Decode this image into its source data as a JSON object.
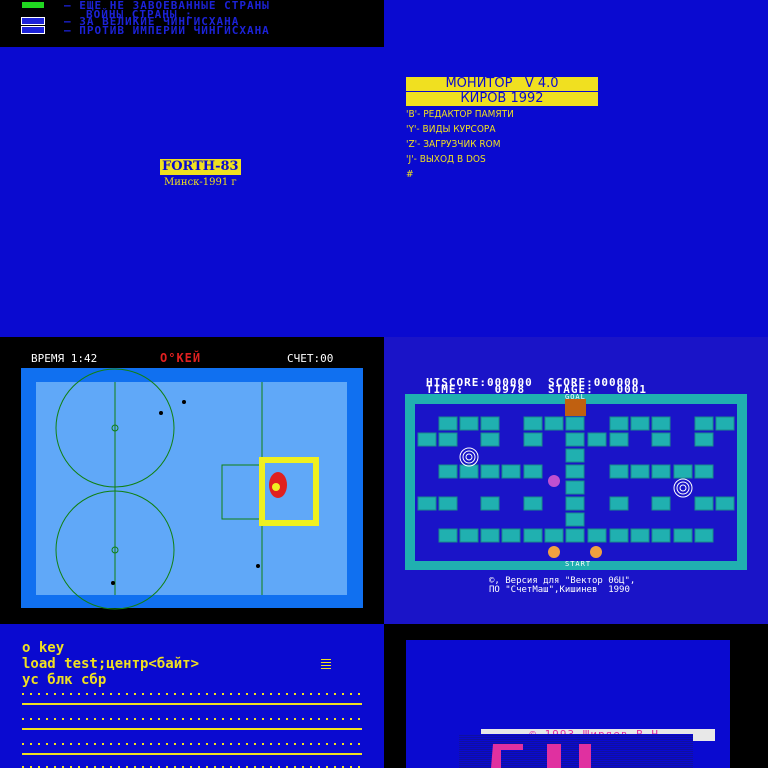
{
  "legend": {
    "rows": [
      {
        "color": "#20d820",
        "text": "– ЕЩЕ НЕ ЗАВОЕВАННЫЕ СТРАНЫ"
      },
      {
        "color": "#1c22d8",
        "text": "ВОЙНЫ СТРАНЫ :"
      },
      {
        "color": "#1c22d8",
        "text": "– ЗА ВЕЛИКИЕ ЧИНГИСХАНА"
      },
      {
        "color": "#1c22d8",
        "text": "– ПРОТИВ ИМПЕРИИ ЧИНГИСХАНА"
      }
    ]
  },
  "forth": {
    "title": "FORTH-83",
    "subtitle": "Минск-1991 г"
  },
  "monitor": {
    "title1": "МОНИТОР   V 4.0",
    "title2": "КИРОВ 1992",
    "menu": [
      "'B'- РЕДАКТОР ПАМЯТИ",
      "'Y'- ВИДЫ КУРСОРА",
      "'Z'- ЗАГРУЗЧИК ROM",
      "'J'- ВЫХОД В DOS",
      "#"
    ]
  },
  "hockey": {
    "time_label": "ВРЕМЯ 1:42",
    "logo": "О°КЕЙ",
    "score_label": "СЧЕТ:00"
  },
  "maze": {
    "hiscore_line": "HISCORE:000000  SCORE:000000",
    "time_line": "TIME:    0978   STAGE:   0001",
    "goal_label": "GOAL",
    "start_label": "START",
    "credit1": "©, Версия для \"Вектор 06Ц\",",
    "credit2": "ПО \"СчетМаш\",Кишинев  1990"
  },
  "terminal": {
    "lines": [
      "o key",
      "load test;центр<байт>",
      "ус блк сбр"
    ]
  },
  "splash": {
    "copyright": "© 1993 Ширяев В.Н."
  },
  "colors": {
    "yellow": "#f0e020",
    "blue": "#0a0ad0",
    "teal": "#20b0b0",
    "orange": "#c06010",
    "magenta": "#e030a0"
  }
}
